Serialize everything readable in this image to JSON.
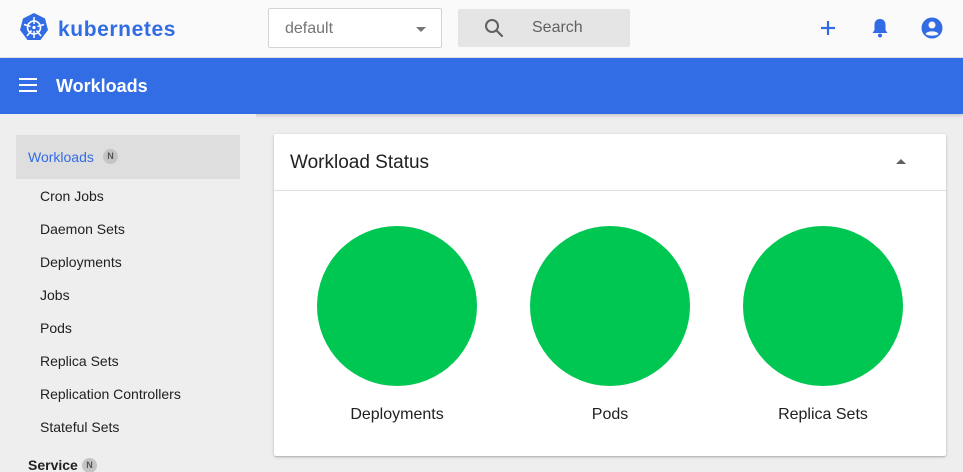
{
  "brand": {
    "name": "kubernetes"
  },
  "namespace": {
    "selected": "default"
  },
  "search": {
    "placeholder": "Search"
  },
  "topbar": {
    "icons": [
      "plus-icon",
      "bell-icon",
      "account-circle-icon"
    ]
  },
  "header": {
    "title": "Workloads"
  },
  "sidebar": {
    "section": {
      "label": "Workloads",
      "badge": "N"
    },
    "items": [
      {
        "label": "Cron Jobs"
      },
      {
        "label": "Daemon Sets"
      },
      {
        "label": "Deployments"
      },
      {
        "label": "Jobs"
      },
      {
        "label": "Pods"
      },
      {
        "label": "Replica Sets"
      },
      {
        "label": "Replication Controllers"
      },
      {
        "label": "Stateful Sets"
      }
    ],
    "section2": {
      "label": "Service",
      "badge": "N"
    }
  },
  "card": {
    "title": "Workload Status",
    "charts": [
      {
        "label": "Deployments"
      },
      {
        "label": "Pods"
      },
      {
        "label": "Replica Sets"
      }
    ]
  },
  "colors": {
    "accent": "#326ce5",
    "status_running": "#00c752"
  }
}
